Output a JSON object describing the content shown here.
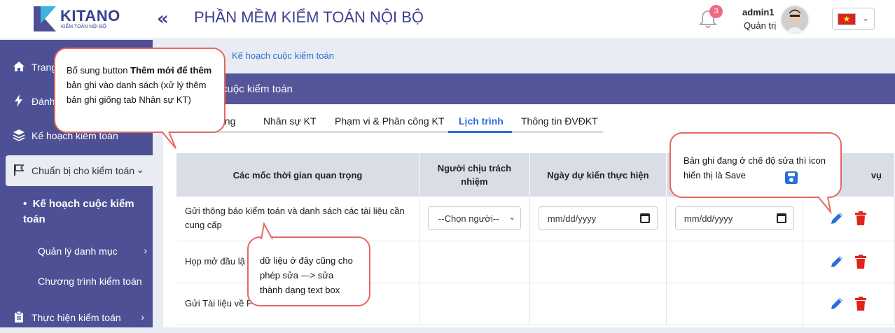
{
  "header": {
    "logo_text": "KITANO",
    "logo_sub": "KIỂM TOÁN NỘI BỘ",
    "title": "PHẦN MỀM KIỂM TOÁN NỘI BỘ",
    "notification_count": "3",
    "user_name": "admin1",
    "user_role": "Quản trị",
    "language_icon": "vietnam-flag"
  },
  "sidebar": {
    "items": [
      {
        "label": "Trang chủ",
        "icon": "home-icon"
      },
      {
        "label": "Đánh giá rủi ro",
        "icon": "bolt-icon"
      },
      {
        "label": "Kế hoạch kiểm toán",
        "icon": "layers-icon"
      },
      {
        "label": "Chuẩn bị cho kiểm toán",
        "icon": "flag-icon"
      },
      {
        "label": "Thực hiện kiểm toán",
        "icon": "clipboard-icon"
      }
    ],
    "sub_items": [
      {
        "label": "Kế hoạch cuộc kiểm toán"
      },
      {
        "label": "Quản lý danh mục"
      },
      {
        "label": "Chương trình kiểm toán"
      }
    ]
  },
  "breadcrumb": "Kế hoạch cuộc kiểm toán",
  "card": {
    "title": "cuộc kiểm toán",
    "tabs": [
      "ung",
      "Nhân sự KT",
      "Phạm vi & Phân công KT",
      "Lịch trình",
      "Thông tin ĐVĐKT"
    ],
    "active_tab": "Lịch trình"
  },
  "table": {
    "columns": [
      "Các mốc thời gian quan trọng",
      "Người chịu trách nhiệm",
      "Ngày dự kiến thực hiện",
      "",
      "vụ"
    ],
    "rows": [
      {
        "milestone": "Gửi thông báo kiểm toán và danh sách các tài liệu cần cung cấp",
        "person_placeholder": "--Chọn người--",
        "date1": "mm/dd/yyyy",
        "date2": "mm/dd/yyyy"
      },
      {
        "milestone": "Họp mở đầu lậ"
      },
      {
        "milestone": "Gửi Tài liệu về F"
      }
    ]
  },
  "callouts": {
    "add_button": {
      "line1": "Bổ sung button ",
      "bold": "Thêm mới để thêm",
      "line2": " bản ghi vào danh sách (xử lý thêm bản ghi giống tab Nhân sự KT)"
    },
    "edit_mode": "Bản ghi đang ở chế độ sửa thì icon hiển thị là Save",
    "textbox": "dữ liệu ở đây cũng cho phép sửa —> sửa thành dạng text box"
  },
  "colors": {
    "brand": "#4e5095",
    "accent": "#2a6dd8",
    "danger": "#e0231c",
    "callout_border": "#e3695e"
  }
}
